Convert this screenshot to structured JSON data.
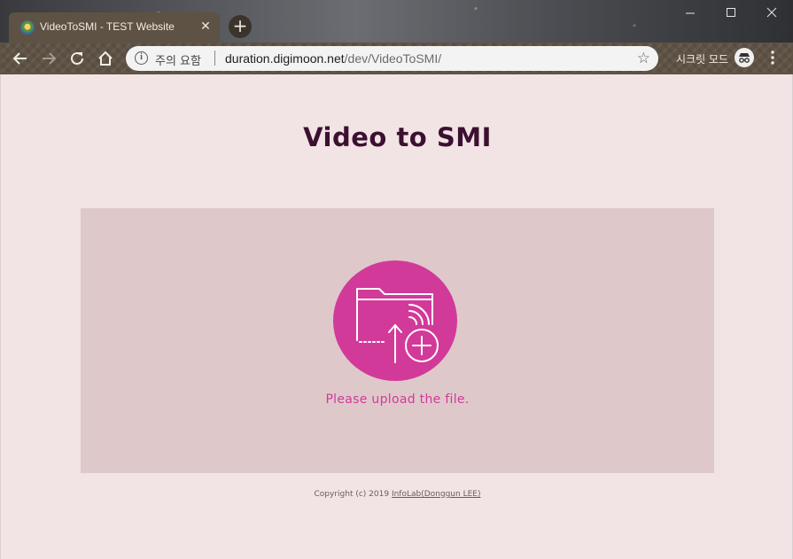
{
  "browser": {
    "tab": {
      "title": "VideoToSMI - TEST Website",
      "close_glyph": "✕"
    },
    "new_tab_glyph": "+",
    "address": {
      "security_label": "주의 요함",
      "url_host": "duration.digimoon.net",
      "url_path": "/dev/VideoToSMI/"
    },
    "incognito_label": "시크릿 모드",
    "icons": [
      "back-icon",
      "forward-icon",
      "reload-icon",
      "home-icon",
      "info-icon",
      "star-icon",
      "incognito-icon",
      "menu-icon",
      "minimize-icon",
      "maximize-icon",
      "close-icon"
    ]
  },
  "page": {
    "title": "Video to SMI",
    "upload_prompt": "Please upload the file.",
    "copyright_prefix": "Copyright (c) 2019 ",
    "copyright_lab": "InfoLab",
    "copyright_author": "(Donggun LEE)"
  },
  "colors": {
    "background": "#f2e4e5",
    "upload_area": "#dfc8ca",
    "accent": "#d23a9a",
    "title": "#3c1030"
  }
}
